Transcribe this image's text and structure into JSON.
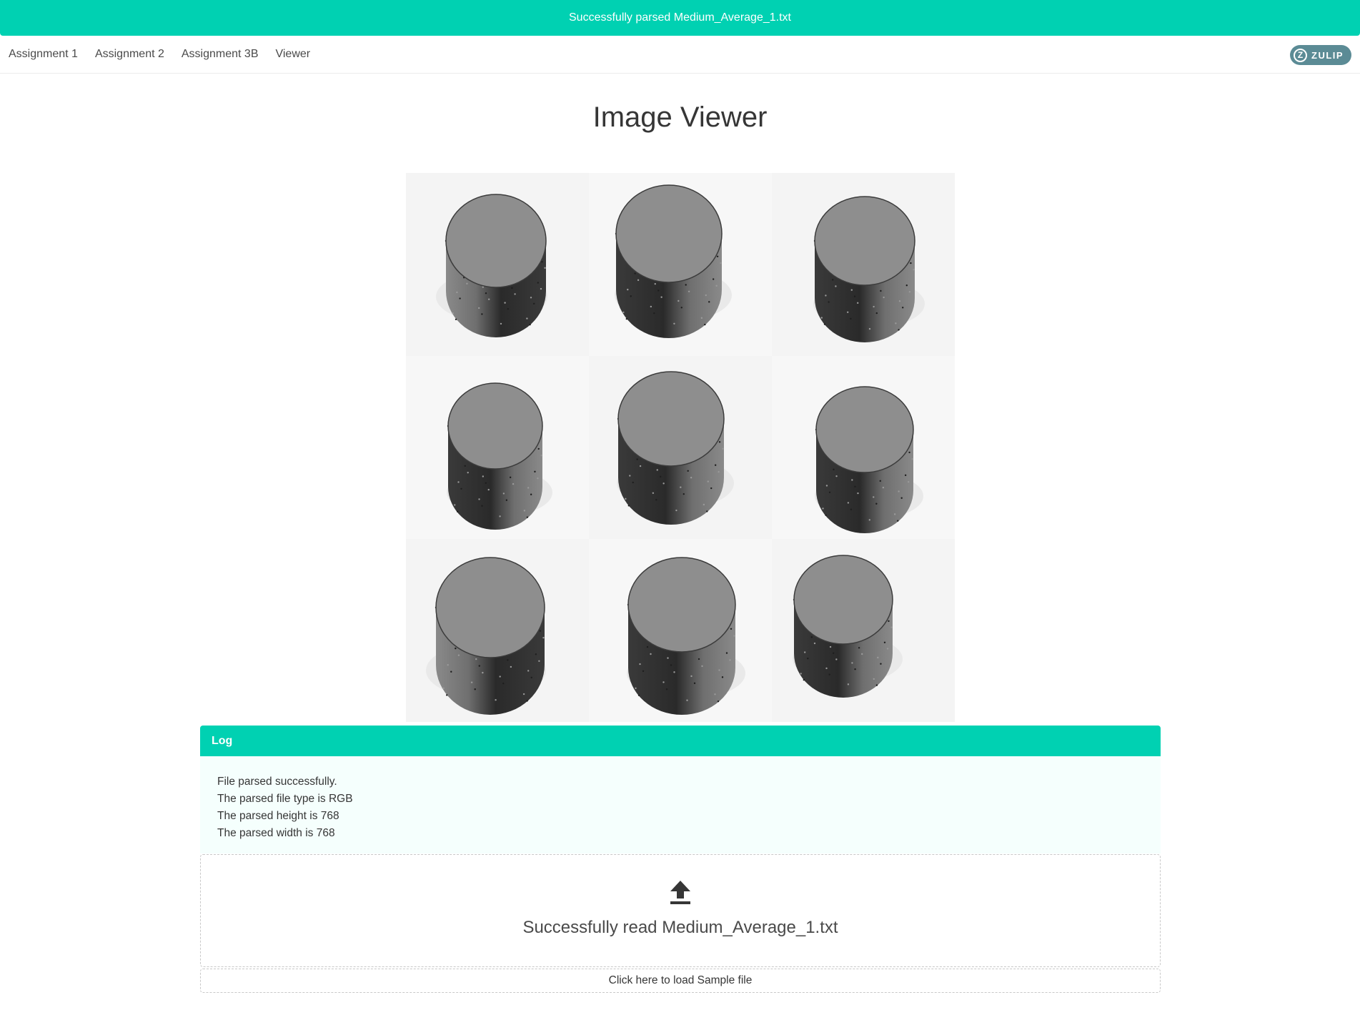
{
  "notification": {
    "text": "Successfully parsed Medium_Average_1.txt"
  },
  "navbar": {
    "items": [
      {
        "label": "Assignment 1"
      },
      {
        "label": "Assignment 2"
      },
      {
        "label": "Assignment 3B"
      },
      {
        "label": "Viewer"
      }
    ],
    "badge": {
      "mark": "Z",
      "label": "ZULIP"
    }
  },
  "page": {
    "title": "Image Viewer"
  },
  "image_grid": {
    "rows": 3,
    "columns": 3,
    "cells": [
      {
        "subject": "cylinder"
      },
      {
        "subject": "cylinder"
      },
      {
        "subject": "cylinder"
      },
      {
        "subject": "cylinder"
      },
      {
        "subject": "cylinder"
      },
      {
        "subject": "cylinder"
      },
      {
        "subject": "cylinder"
      },
      {
        "subject": "cylinder"
      },
      {
        "subject": "cylinder"
      }
    ]
  },
  "log": {
    "header": "Log",
    "lines": [
      "File parsed successfully.",
      "The parsed file type is RGB",
      "The parsed height is 768",
      "The parsed width is 768"
    ]
  },
  "upload": {
    "icon": "upload-icon",
    "status": "Successfully read Medium_Average_1.txt",
    "sample_link": "Click here to load Sample file"
  },
  "colors": {
    "accent": "#00d1b2",
    "log_background": "#f5fffd",
    "zulip_badge": "#5b8b95"
  }
}
